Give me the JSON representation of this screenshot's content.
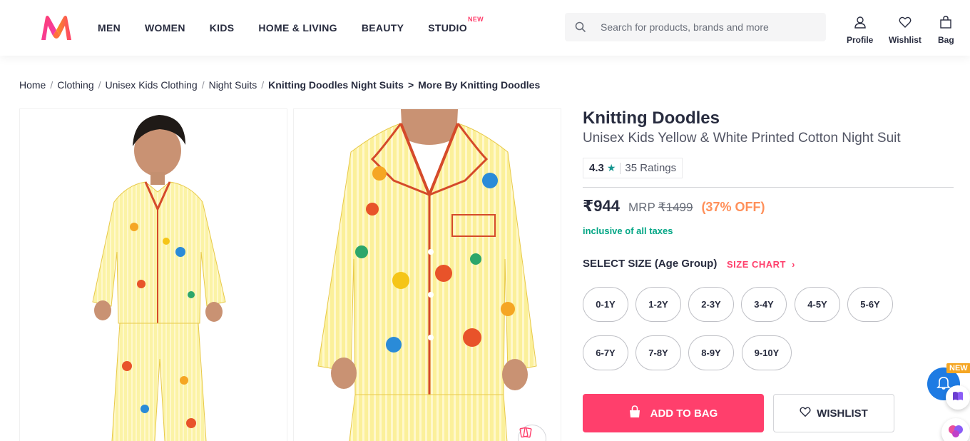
{
  "header": {
    "logo_icon": "myntra-logo",
    "nav": [
      {
        "label": "MEN"
      },
      {
        "label": "WOMEN"
      },
      {
        "label": "KIDS"
      },
      {
        "label": "HOME & LIVING"
      },
      {
        "label": "BEAUTY"
      },
      {
        "label": "STUDIO",
        "badge": "NEW"
      }
    ],
    "search": {
      "placeholder": "Search for products, brands and more",
      "icon": "search-icon"
    },
    "actions": [
      {
        "label": "Profile",
        "icon": "profile-icon"
      },
      {
        "label": "Wishlist",
        "icon": "heart-icon"
      },
      {
        "label": "Bag",
        "icon": "bag-icon"
      }
    ]
  },
  "breadcrumb": [
    {
      "label": "Home"
    },
    {
      "label": "Clothing"
    },
    {
      "label": "Unisex Kids Clothing"
    },
    {
      "label": "Night Suits"
    },
    {
      "label": "Knitting Doodles Night Suits"
    },
    {
      "label": "More By Knitting Doodles"
    }
  ],
  "product": {
    "brand": "Knitting Doodles",
    "name": "Unisex Kids Yellow & White Printed Cotton Night Suit",
    "rating": "4.3",
    "rating_icon": "star-icon",
    "ratings_count": "35 Ratings",
    "price": "₹944",
    "mrp_label": "MRP",
    "mrp": "₹1499",
    "discount": "(37% OFF)",
    "taxes_note": "inclusive of all taxes",
    "size_title": "SELECT SIZE (Age Group)",
    "size_chart": "SIZE CHART",
    "sizes": [
      "0-1Y",
      "1-2Y",
      "2-3Y",
      "3-4Y",
      "4-5Y",
      "5-6Y",
      "6-7Y",
      "7-8Y",
      "8-9Y",
      "9-10Y"
    ],
    "add_to_bag": "ADD TO BAG",
    "wishlist": "WISHLIST"
  },
  "widgets": {
    "notification_badge": "NEW"
  },
  "colors": {
    "accent": "#ff3f6c",
    "discount": "#ff905a",
    "tax": "#03a685",
    "rating_star": "#14958f"
  }
}
